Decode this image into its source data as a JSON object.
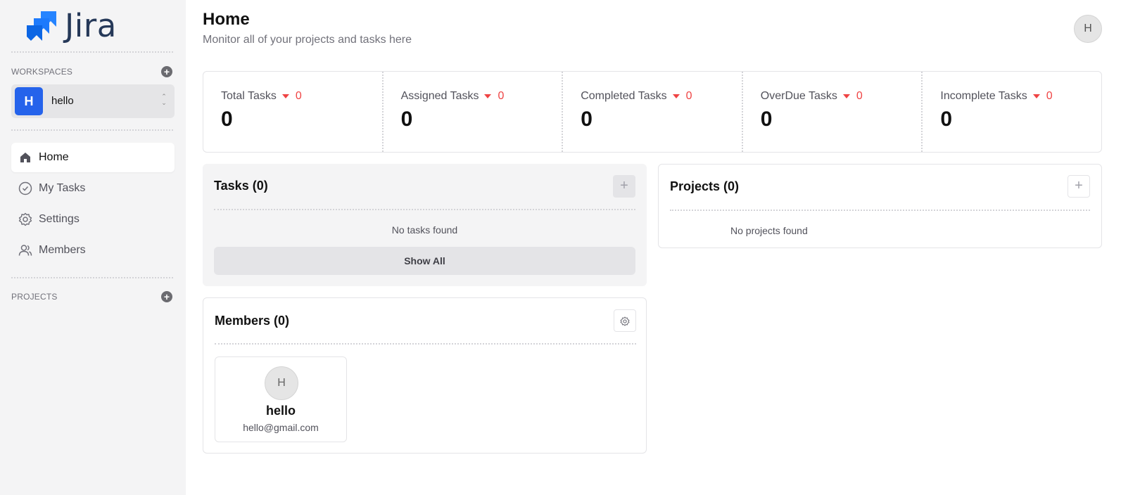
{
  "app": {
    "logo_text": "Jira"
  },
  "sidebar": {
    "workspaces_label": "WORKSPACES",
    "workspace": {
      "initial": "H",
      "name": "hello"
    },
    "nav": [
      {
        "label": "Home",
        "icon": "home-icon",
        "active": true
      },
      {
        "label": "My Tasks",
        "icon": "check-circle-icon",
        "active": false
      },
      {
        "label": "Settings",
        "icon": "gear-icon",
        "active": false
      },
      {
        "label": "Members",
        "icon": "users-icon",
        "active": false
      }
    ],
    "projects_label": "PROJECTS"
  },
  "header": {
    "title": "Home",
    "subtitle": "Monitor all of your projects and tasks here",
    "user_initial": "H"
  },
  "stats": [
    {
      "label": "Total Tasks",
      "delta": "0",
      "value": "0"
    },
    {
      "label": "Assigned Tasks",
      "delta": "0",
      "value": "0"
    },
    {
      "label": "Completed Tasks",
      "delta": "0",
      "value": "0"
    },
    {
      "label": "OverDue Tasks",
      "delta": "0",
      "value": "0"
    },
    {
      "label": "Incomplete Tasks",
      "delta": "0",
      "value": "0"
    }
  ],
  "tasks": {
    "title": "Tasks (0)",
    "empty": "No tasks found",
    "show_all": "Show All"
  },
  "projects": {
    "title": "Projects (0)",
    "empty": "No projects found"
  },
  "members": {
    "title": "Members (0)",
    "list": [
      {
        "initial": "H",
        "name": "hello",
        "email": "hello@gmail.com"
      }
    ]
  },
  "colors": {
    "accent": "#2563eb",
    "negative": "#ef4444",
    "sidebar_bg": "#f4f4f5"
  }
}
